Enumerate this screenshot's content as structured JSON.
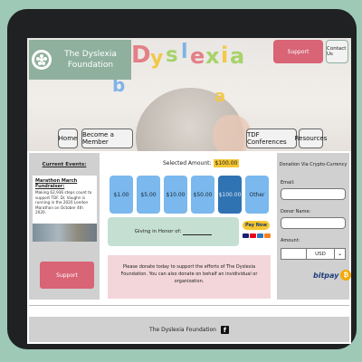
{
  "header": {
    "org_name": "The Dyslexia Foundation",
    "hero_letters": [
      "D",
      "y",
      "s",
      "l",
      "e",
      "x",
      "i",
      "a"
    ],
    "support_label": "Support",
    "contact_label": "Contact Us"
  },
  "nav": {
    "home": "Home",
    "become_member": "Become a Member",
    "conferences": "TDF Conferences",
    "resources": "Resources"
  },
  "events": {
    "title": "Current Events:",
    "card_title": "Marathon March Fundraiser:",
    "card_text": "Making 62,936 steps count to support TDF. Dr. Vaughn is running in the 2020 London Marathon on October 4th 2020.",
    "support_label": "Support"
  },
  "donation": {
    "selected_label": "Selected Amount:",
    "selected_amount": "$100.00",
    "amounts": [
      "$1.00",
      "$5.00",
      "$10.00",
      "$50.00",
      "$100.00",
      "Other"
    ],
    "selected_index": 4,
    "honor_label": "Giving in Honor of:",
    "paynow_label": "Pay Now",
    "notice": "Please donate today to support the efforts of The Dyslexia Foundation. You can also donate on behalf an invidividual or organization."
  },
  "crypto": {
    "title": "Donation Via Crypto-Currency",
    "email_label": "Email:",
    "donor_label": "Donor Name:",
    "amount_label": "Amount:",
    "currency": "USD",
    "provider": "bitpay",
    "coin_symbol": "₿"
  },
  "footer": {
    "text": "The Dyslexia Foundation",
    "social_icon": "facebook-icon"
  },
  "colors": {
    "brand_green": "#8fb09d",
    "support_pink": "#d86476",
    "amount_blue": "#7ab8ed",
    "amount_selected": "#2f73b3",
    "highlight_yellow": "#f5c630"
  }
}
